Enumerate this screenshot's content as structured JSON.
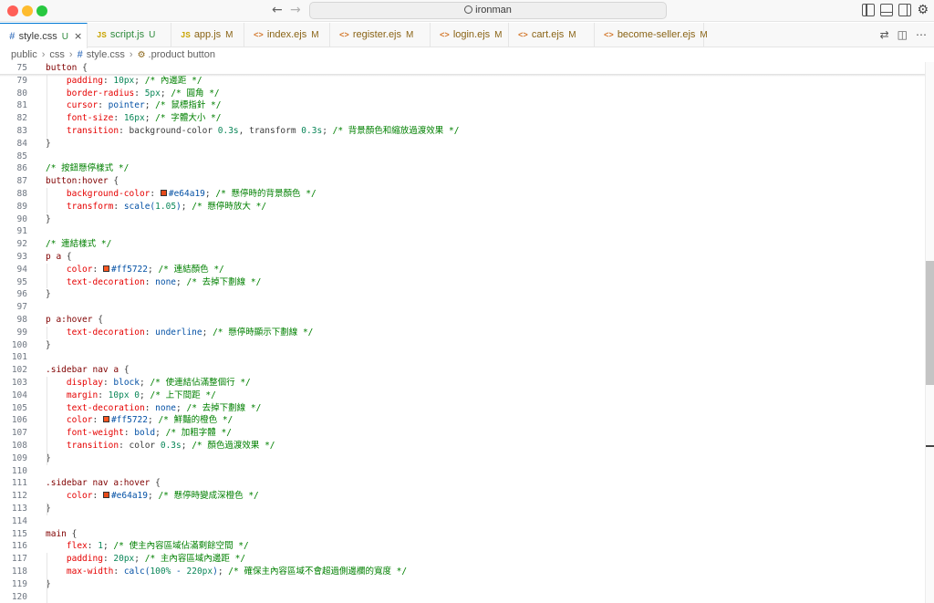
{
  "window": {
    "title": "ironman"
  },
  "tabs": [
    {
      "label": "style.css",
      "status": "U",
      "type": "css",
      "active": true
    },
    {
      "label": "script.js",
      "status": "U",
      "type": "js",
      "active": false
    },
    {
      "label": "app.js",
      "status": "M",
      "type": "js",
      "active": false
    },
    {
      "label": "index.ejs",
      "status": "M",
      "type": "ejs",
      "active": false
    },
    {
      "label": "register.ejs",
      "status": "M",
      "type": "ejs",
      "active": false
    },
    {
      "label": "login.ejs",
      "status": "M",
      "type": "ejs",
      "active": false
    },
    {
      "label": "cart.ejs",
      "status": "M",
      "type": "ejs",
      "active": false
    },
    {
      "label": "become-seller.ejs",
      "status": "M",
      "type": "ejs",
      "active": false
    }
  ],
  "breadcrumb": {
    "part1": "public",
    "part2": "css",
    "part3": "style.css",
    "part4": ".product button"
  },
  "colors": {
    "accent": "#0078d4",
    "swatch1": "#e64a19",
    "swatch2": "#ff5722"
  },
  "icons": [
    "close-icon",
    "search-icon",
    "gear-icon",
    "split-editor-icon",
    "more-icon",
    "compare-icon"
  ],
  "lines": [
    {
      "n": "75",
      "segs": [
        [
          "sel",
          "button"
        ],
        [
          "",
          "{"
        ]
      ]
    },
    {
      "n": "79",
      "segs": [
        [
          "",
          "    "
        ],
        [
          "prop",
          "padding"
        ],
        [
          "",
          ": "
        ],
        [
          "num",
          "10px"
        ],
        [
          "",
          ";"
        ],
        [
          "cmt",
          " /* 內邊距 */"
        ]
      ]
    },
    {
      "n": "80",
      "segs": [
        [
          "",
          "    "
        ],
        [
          "prop",
          "border-radius"
        ],
        [
          "",
          ": "
        ],
        [
          "num",
          "5px"
        ],
        [
          "",
          ";"
        ],
        [
          "cmt",
          " /* 圓角 */"
        ]
      ]
    },
    {
      "n": "81",
      "segs": [
        [
          "",
          "    "
        ],
        [
          "prop",
          "cursor"
        ],
        [
          "",
          ": "
        ],
        [
          "val",
          "pointer"
        ],
        [
          "",
          ";"
        ],
        [
          "cmt",
          " /* 鼠標指針 */"
        ]
      ]
    },
    {
      "n": "82",
      "segs": [
        [
          "",
          "    "
        ],
        [
          "prop",
          "font-size"
        ],
        [
          "",
          ": "
        ],
        [
          "num",
          "16px"
        ],
        [
          "",
          ";"
        ],
        [
          "cmt",
          " /* 字體大小 */"
        ]
      ]
    },
    {
      "n": "83",
      "segs": [
        [
          "",
          "    "
        ],
        [
          "prop",
          "transition"
        ],
        [
          "",
          ": background-color "
        ],
        [
          "num",
          "0.3s"
        ],
        [
          "",
          ", transform "
        ],
        [
          "num",
          "0.3s"
        ],
        [
          "",
          ";"
        ],
        [
          "cmt",
          " /* 背景顏色和縮放過渡效果 */"
        ]
      ]
    },
    {
      "n": "84",
      "segs": [
        [
          "",
          "}"
        ]
      ]
    },
    {
      "n": "85",
      "segs": []
    },
    {
      "n": "86",
      "segs": [
        [
          "cmt",
          "/* 按鈕懸停樣式 */"
        ]
      ]
    },
    {
      "n": "87",
      "segs": [
        [
          "sel",
          "button:hover"
        ],
        [
          "",
          ""
        ],
        [
          "",
          "{"
        ]
      ]
    },
    {
      "n": "88",
      "segs": [
        [
          "",
          "    "
        ],
        [
          "prop",
          "background-color"
        ],
        [
          "",
          ": "
        ],
        [
          "sw1",
          ""
        ],
        [
          "val",
          "#e64a19"
        ],
        [
          "",
          ";"
        ],
        [
          "cmt",
          " /* 懸停時的背景顏色 */"
        ]
      ]
    },
    {
      "n": "89",
      "segs": [
        [
          "",
          "    "
        ],
        [
          "prop",
          "transform"
        ],
        [
          "",
          ": "
        ],
        [
          "val",
          "scale("
        ],
        [
          "num",
          "1.05"
        ],
        [
          "val",
          ")"
        ],
        [
          "",
          ";"
        ],
        [
          "cmt",
          " /* 懸停時放大 */"
        ]
      ]
    },
    {
      "n": "90",
      "segs": [
        [
          "",
          "}"
        ]
      ]
    },
    {
      "n": "91",
      "segs": []
    },
    {
      "n": "92",
      "segs": [
        [
          "cmt",
          "/* 連結樣式 */"
        ]
      ]
    },
    {
      "n": "93",
      "segs": [
        [
          "sel",
          "p a"
        ],
        [
          "",
          ""
        ],
        [
          "",
          "{"
        ]
      ]
    },
    {
      "n": "94",
      "segs": [
        [
          "",
          "    "
        ],
        [
          "prop",
          "color"
        ],
        [
          "",
          ": "
        ],
        [
          "sw2",
          ""
        ],
        [
          "val",
          "#ff5722"
        ],
        [
          "",
          ";"
        ],
        [
          "cmt",
          " /* 連結顏色 */"
        ]
      ]
    },
    {
      "n": "95",
      "segs": [
        [
          "",
          "    "
        ],
        [
          "prop",
          "text-decoration"
        ],
        [
          "",
          ": "
        ],
        [
          "val",
          "none"
        ],
        [
          "",
          ";"
        ],
        [
          "cmt",
          " /* 去掉下劃線 */"
        ]
      ]
    },
    {
      "n": "96",
      "segs": [
        [
          "",
          "}"
        ]
      ]
    },
    {
      "n": "97",
      "segs": []
    },
    {
      "n": "98",
      "segs": [
        [
          "sel",
          "p a:hover"
        ],
        [
          "",
          ""
        ],
        [
          "",
          "{"
        ]
      ]
    },
    {
      "n": "99",
      "segs": [
        [
          "",
          "    "
        ],
        [
          "prop",
          "text-decoration"
        ],
        [
          "",
          ": "
        ],
        [
          "val",
          "underline"
        ],
        [
          "",
          ";"
        ],
        [
          "cmt",
          " /* 懸停時顯示下劃線 */"
        ]
      ]
    },
    {
      "n": "100",
      "segs": [
        [
          "",
          "}"
        ]
      ]
    },
    {
      "n": "101",
      "segs": []
    },
    {
      "n": "102",
      "segs": [
        [
          "sel",
          ".sidebar nav a"
        ],
        [
          "",
          ""
        ],
        [
          "",
          "{"
        ]
      ]
    },
    {
      "n": "103",
      "segs": [
        [
          "",
          "    "
        ],
        [
          "prop",
          "display"
        ],
        [
          "",
          ": "
        ],
        [
          "val",
          "block"
        ],
        [
          "",
          ";"
        ],
        [
          "cmt",
          " /* 使連結佔滿整個行 */"
        ]
      ]
    },
    {
      "n": "104",
      "segs": [
        [
          "",
          "    "
        ],
        [
          "prop",
          "margin"
        ],
        [
          "",
          ": "
        ],
        [
          "num",
          "10px"
        ],
        [
          "",
          ""
        ],
        [
          "num",
          "0"
        ],
        [
          "",
          ";"
        ],
        [
          "cmt",
          " /* 上下間距 */"
        ]
      ]
    },
    {
      "n": "105",
      "segs": [
        [
          "",
          "    "
        ],
        [
          "prop",
          "text-decoration"
        ],
        [
          "",
          ": "
        ],
        [
          "val",
          "none"
        ],
        [
          "",
          ";"
        ],
        [
          "cmt",
          " /* 去掉下劃線 */"
        ]
      ]
    },
    {
      "n": "106",
      "segs": [
        [
          "",
          "    "
        ],
        [
          "prop",
          "color"
        ],
        [
          "",
          ": "
        ],
        [
          "sw2",
          ""
        ],
        [
          "val",
          "#ff5722"
        ],
        [
          "",
          ";"
        ],
        [
          "cmt",
          " /* 鮮豔的橙色 */"
        ]
      ]
    },
    {
      "n": "107",
      "segs": [
        [
          "",
          "    "
        ],
        [
          "prop",
          "font-weight"
        ],
        [
          "",
          ": "
        ],
        [
          "val",
          "bold"
        ],
        [
          "",
          ";"
        ],
        [
          "cmt",
          " /* 加粗字體 */"
        ]
      ]
    },
    {
      "n": "108",
      "segs": [
        [
          "",
          "    "
        ],
        [
          "prop",
          "transition"
        ],
        [
          "",
          ": color "
        ],
        [
          "num",
          "0.3s"
        ],
        [
          "",
          ";"
        ],
        [
          "cmt",
          " /* 顏色過渡效果 */"
        ]
      ]
    },
    {
      "n": "109",
      "segs": [
        [
          "",
          "}"
        ]
      ]
    },
    {
      "n": "110",
      "segs": []
    },
    {
      "n": "111",
      "segs": [
        [
          "sel",
          ".sidebar nav a:hover"
        ],
        [
          "",
          ""
        ],
        [
          "",
          "{"
        ]
      ]
    },
    {
      "n": "112",
      "segs": [
        [
          "",
          "    "
        ],
        [
          "prop",
          "color"
        ],
        [
          "",
          ": "
        ],
        [
          "sw1",
          ""
        ],
        [
          "val",
          "#e64a19"
        ],
        [
          "",
          ";"
        ],
        [
          "cmt",
          " /* 懸停時變成深橙色 */"
        ]
      ]
    },
    {
      "n": "113",
      "segs": [
        [
          "",
          "}"
        ]
      ]
    },
    {
      "n": "114",
      "segs": []
    },
    {
      "n": "115",
      "segs": [
        [
          "sel",
          "main"
        ],
        [
          "",
          ""
        ],
        [
          "",
          "{"
        ]
      ]
    },
    {
      "n": "116",
      "segs": [
        [
          "",
          "    "
        ],
        [
          "prop",
          "flex"
        ],
        [
          "",
          ": "
        ],
        [
          "num",
          "1"
        ],
        [
          "",
          ";"
        ],
        [
          "cmt",
          " /* 使主內容區域佔滿剩餘空間 */"
        ]
      ]
    },
    {
      "n": "117",
      "segs": [
        [
          "",
          "    "
        ],
        [
          "prop",
          "padding"
        ],
        [
          "",
          ": "
        ],
        [
          "num",
          "20px"
        ],
        [
          "",
          ";"
        ],
        [
          "cmt",
          " /* 主內容區域內邊距 */"
        ]
      ]
    },
    {
      "n": "118",
      "segs": [
        [
          "",
          "    "
        ],
        [
          "prop",
          "max-width"
        ],
        [
          "",
          ": "
        ],
        [
          "val",
          "calc("
        ],
        [
          "num",
          "100%"
        ],
        [
          "val",
          " - "
        ],
        [
          "num",
          "220px"
        ],
        [
          "val",
          ")"
        ],
        [
          "",
          ";"
        ],
        [
          "cmt",
          " /* 確保主內容區域不會超過側邊欄的寬度 */"
        ]
      ]
    },
    {
      "n": "119",
      "segs": [
        [
          "",
          "}"
        ]
      ]
    },
    {
      "n": "120",
      "segs": []
    }
  ]
}
